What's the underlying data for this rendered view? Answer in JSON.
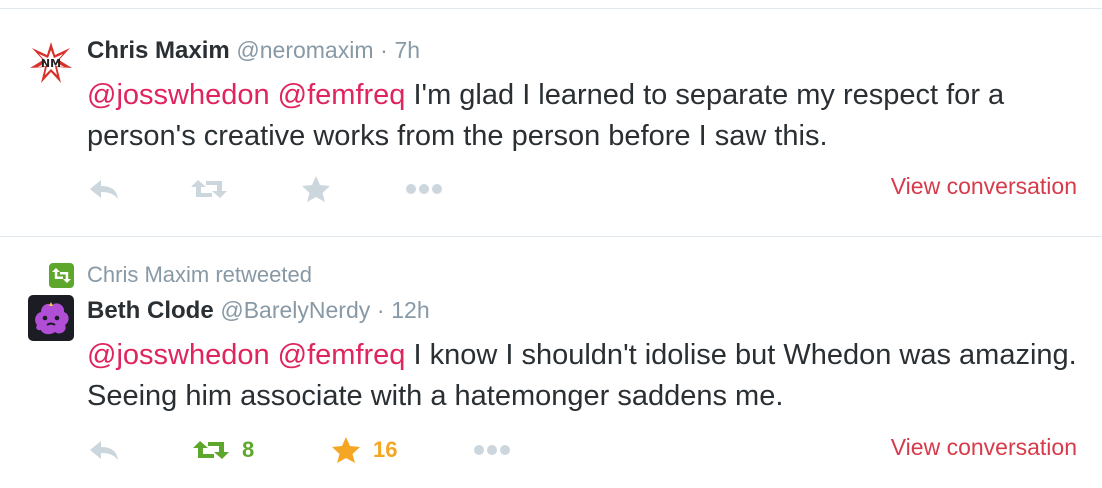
{
  "tweets": [
    {
      "fullname": "Chris Maxim",
      "handle": "@neromaxim",
      "separator": "·",
      "time": "7h",
      "mention1": "@josswhedon",
      "mention2": "@femfreq",
      "body": " I'm glad I learned to separate my respect for a person's creative works from the person before I saw this.",
      "avatar_icon": "nero-logo-avatar",
      "view_conversation": "View conversation",
      "actions": [
        "reply-icon",
        "retweet-icon",
        "favorite-icon",
        "more-icon"
      ]
    },
    {
      "retweet_context": "Chris Maxim retweeted",
      "fullname": "Beth Clode",
      "handle": "@BarelyNerdy",
      "separator": "·",
      "time": "12h",
      "mention1": "@josswhedon",
      "mention2": "@femfreq",
      "body": " I know I shouldn't idolise but Whedon was amazing. Seeing him associate with a hatemonger saddens me.",
      "avatar_icon": "lumpy-space-princess-avatar",
      "retweet_count": "8",
      "favorite_count": "16",
      "view_conversation": "View conversation",
      "actions": [
        "reply-icon",
        "retweet-icon",
        "favorite-icon",
        "more-icon"
      ]
    }
  ],
  "colors": {
    "mention": "#e0245e",
    "meta": "#8899a6",
    "action_icon": "#ccd6dd",
    "retweeted_green": "#5ea72d",
    "favorited_gold": "#f5a623",
    "view_conversation": "#d73a4a"
  }
}
